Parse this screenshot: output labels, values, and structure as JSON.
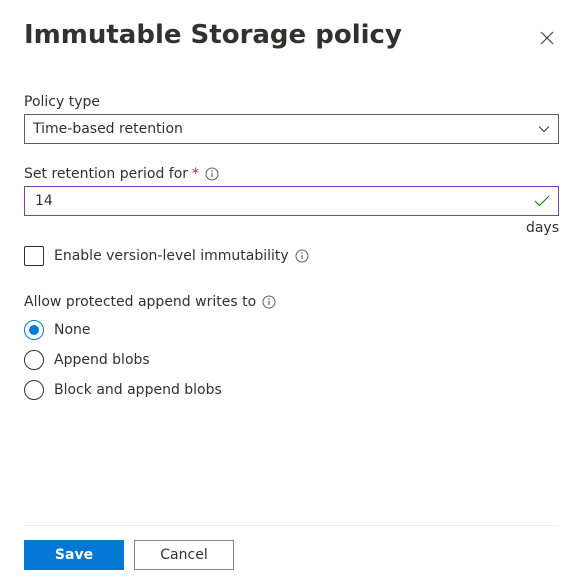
{
  "header": {
    "title": "Immutable Storage policy"
  },
  "policy_type": {
    "label": "Policy type",
    "value": "Time-based retention"
  },
  "retention": {
    "label": "Set retention period for",
    "value": "14",
    "unit": "days"
  },
  "version_level": {
    "label": "Enable version-level immutability",
    "checked": false
  },
  "append_writes": {
    "label": "Allow protected append writes to",
    "options": [
      {
        "label": "None",
        "selected": true
      },
      {
        "label": "Append blobs",
        "selected": false
      },
      {
        "label": "Block and append blobs",
        "selected": false
      }
    ]
  },
  "footer": {
    "save": "Save",
    "cancel": "Cancel"
  }
}
